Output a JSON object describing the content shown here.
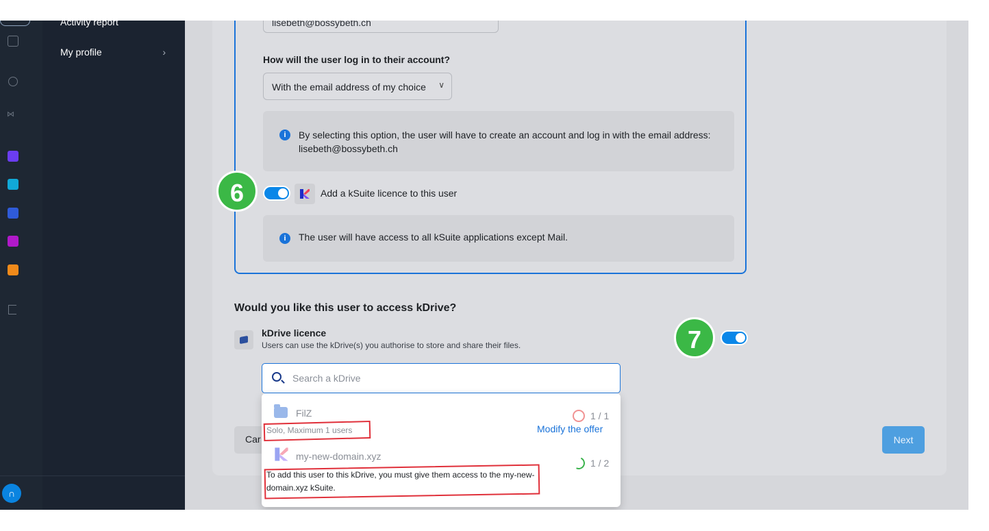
{
  "menu": {
    "items": [
      {
        "label": "Activity report"
      },
      {
        "label": "My profile",
        "chevron": "›"
      }
    ]
  },
  "rail": {
    "icons": [
      "building-icon",
      "headset-icon",
      "handshake-icon",
      "ksuite-app-icon",
      "kmeet-app-icon",
      "kdrive-app-icon",
      "kchat-app-icon",
      "swisstransfer-app-icon",
      "logout-icon",
      "support-icon"
    ],
    "app_colors": [
      "#6b3df0",
      "#11a9d8",
      "#2f5bd8",
      "#b019c9",
      "#f08a1a"
    ]
  },
  "form": {
    "email_value": "lisebeth@bossybeth.ch",
    "login_question": "How will the user log in to their account?",
    "login_select_value": "With the email address of my choice",
    "info_login": "By selecting this option, the user will have to create an account and log in with the email address: lisebeth@bossybeth.ch",
    "ksuite_toggle_label": "Add a kSuite licence to this user",
    "ksuite_toggle_on": true,
    "info_ksuite": "The user will have access to all kSuite applications except Mail.",
    "info_icon": "i"
  },
  "kdrive": {
    "section_title": "Would you like this user to access kDrive?",
    "licence_title": "kDrive licence",
    "licence_desc": "Users can use the kDrive(s) you authorise to store and share their files.",
    "licence_toggle_on": true,
    "search_placeholder": "Search a kDrive",
    "results": [
      {
        "name": "FilZ",
        "subtitle": "Solo, Maximum 1 users",
        "count": "1 / 1",
        "action": "Modify the offer"
      },
      {
        "name": "my-new-domain.xyz",
        "subtitle": "To add this user to this kDrive, you must give them access to the my-new-domain.xyz kSuite.",
        "count": "1 / 2"
      }
    ]
  },
  "buttons": {
    "cancel": "Car",
    "next": "Next"
  },
  "annotations": {
    "step6": "6",
    "step7": "7",
    "badge_color": "#3bb846",
    "highlight_color": "#e0303a"
  },
  "colors": {
    "accent": "#1a73d9",
    "toggle_on": "#0b87e8",
    "sidebar": "#1b2330"
  }
}
